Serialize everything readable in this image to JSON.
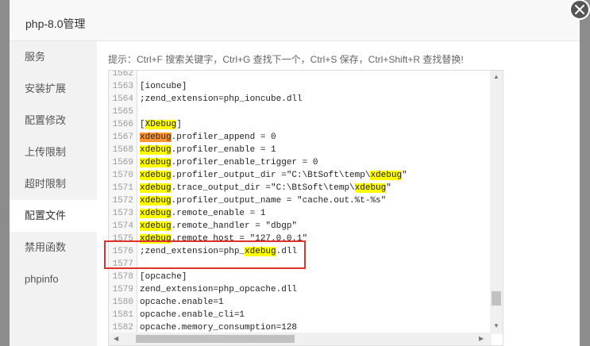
{
  "dialog": {
    "title": "php-8.0管理"
  },
  "sidebar": {
    "items": [
      {
        "label": "服务"
      },
      {
        "label": "安装扩展"
      },
      {
        "label": "配置修改"
      },
      {
        "label": "上传限制"
      },
      {
        "label": "超时限制"
      },
      {
        "label": "配置文件"
      },
      {
        "label": "禁用函数"
      },
      {
        "label": "phpinfo"
      }
    ],
    "active": "配置文件"
  },
  "main": {
    "hint": "提示：Ctrl+F 搜索关键字，Ctrl+G 查找下一个，Ctrl+S 保存，Ctrl+Shift+R 查找替换!"
  },
  "editor": {
    "lines": [
      {
        "n": "1562",
        "t": ""
      },
      {
        "n": "1563",
        "t": "[ioncube]"
      },
      {
        "n": "1564",
        "t": ";zend_extension=php_ioncube.dll"
      },
      {
        "n": "1565",
        "t": ""
      },
      {
        "n": "1566",
        "t": "[XDebug]"
      },
      {
        "n": "1567",
        "t": "xdebug.profiler_append = 0"
      },
      {
        "n": "1568",
        "t": "xdebug.profiler_enable = 1"
      },
      {
        "n": "1569",
        "t": "xdebug.profiler_enable_trigger = 0"
      },
      {
        "n": "1570",
        "t": "xdebug.profiler_output_dir =\"C:\\BtSoft\\temp\\xdebug\""
      },
      {
        "n": "1571",
        "t": "xdebug.trace_output_dir =\"C:\\BtSoft\\temp\\xdebug\""
      },
      {
        "n": "1572",
        "t": "xdebug.profiler_output_name = \"cache.out.%t-%s\""
      },
      {
        "n": "1573",
        "t": "xdebug.remote_enable = 1"
      },
      {
        "n": "1574",
        "t": "xdebug.remote_handler = \"dbgp\""
      },
      {
        "n": "1575",
        "t": "xdebug.remote_host = \"127.0.0.1\""
      },
      {
        "n": "1576",
        "t": ";zend_extension=php_xdebug.dll"
      },
      {
        "n": "1577",
        "t": ""
      },
      {
        "n": "1578",
        "t": "[opcache]"
      },
      {
        "n": "1579",
        "t": "zend_extension=php_opcache.dll"
      },
      {
        "n": "1580",
        "t": "opcache.enable=1"
      },
      {
        "n": "1581",
        "t": "opcache.enable_cli=1"
      },
      {
        "n": "1582",
        "t": "opcache.memory_consumption=128"
      }
    ],
    "highlight_term": "xdebug"
  },
  "colors": {
    "highlight": "#ffff00",
    "current_match": "#ff9632",
    "annotation_box": "#e0322b"
  }
}
